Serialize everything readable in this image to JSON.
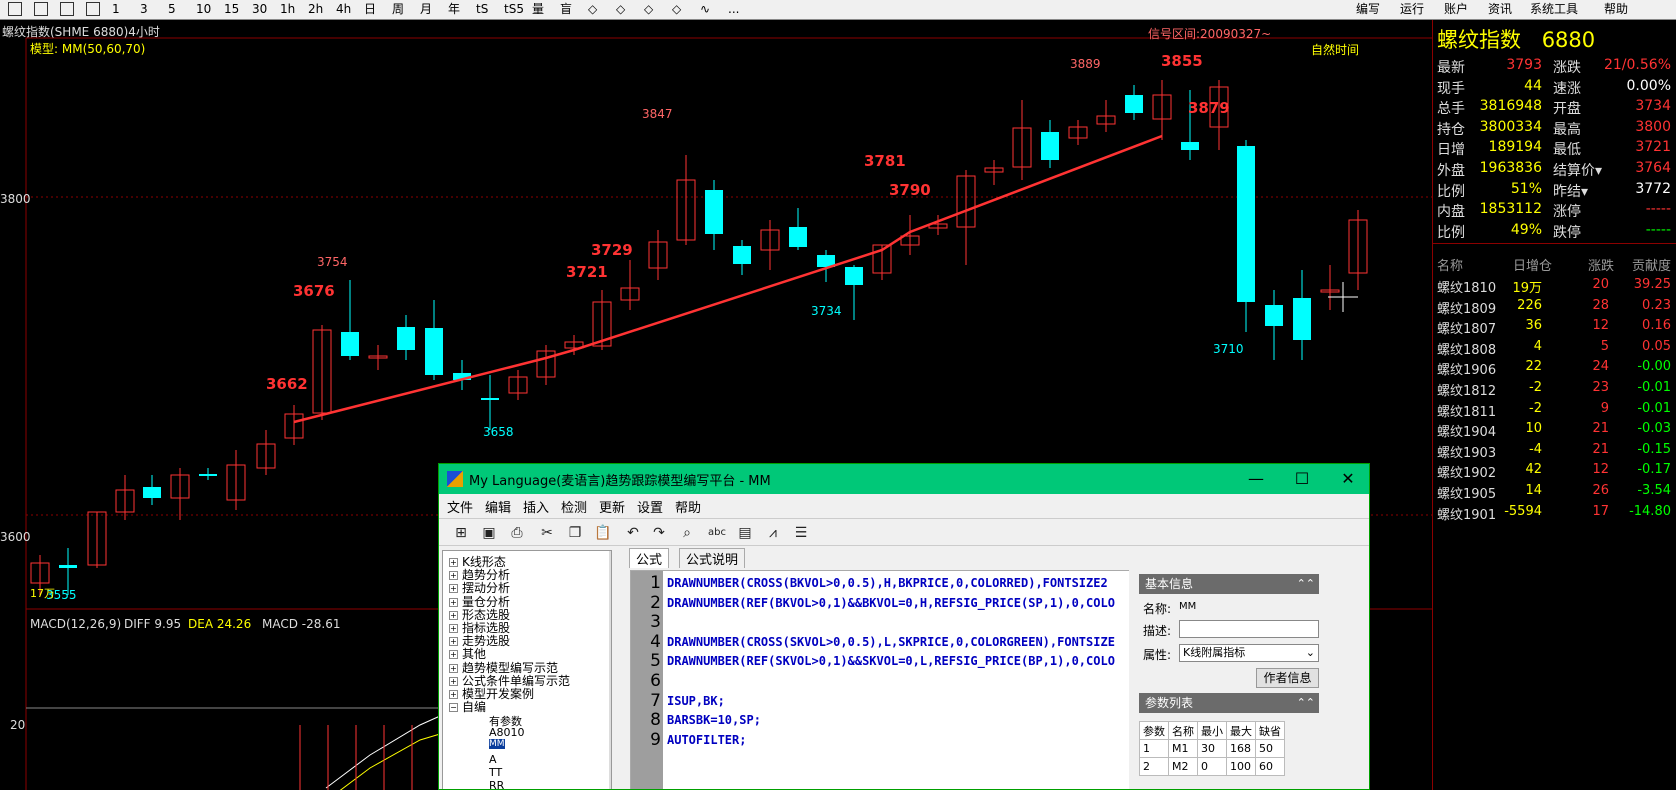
{
  "top_toolbar": {
    "left_items": [
      "1",
      "3",
      "5",
      "10",
      "15",
      "30",
      "1h",
      "2h",
      "4h",
      "日",
      "周",
      "月",
      "年",
      "tS",
      "tS5",
      "量",
      "盲",
      "◇",
      "◇",
      "◇",
      "◇",
      "∿",
      "..."
    ],
    "right_items": [
      "编写",
      "运行",
      "账户",
      "资讯",
      "系统工具",
      "帮助"
    ]
  },
  "chart": {
    "symbol_title": "螺纹指数(SHME 6880)4小时",
    "model_label": "模型: MM(50,60,70)",
    "signal_interval": "信号区间:20090327~",
    "natural_time": "自然时间",
    "y_ticks": [
      "3800",
      "3600",
      "20"
    ],
    "price_labels": {
      "p3889": "3889",
      "p3855": "3855",
      "p3879": "3879",
      "p3847": "3847",
      "p3781": "3781",
      "p3790": "3790",
      "p3754": "3754",
      "p3676": "3676",
      "p3729": "3729",
      "p3721": "3721",
      "p3662": "3662",
      "p3734": "3734",
      "p3710": "3710",
      "p3658": "3658",
      "p3555": "3555",
      "small_17": "17万"
    },
    "macd": {
      "label": "MACD(12,26,9)",
      "diff": "DIFF 9.95",
      "dea": "DEA 24.26",
      "macd": "MACD -28.61"
    },
    "colors": {
      "up": "#ff3333",
      "down": "#00ffff",
      "signal": "#ff3333",
      "grid": "#8b0000"
    }
  },
  "info_panel": {
    "title": "螺纹指数",
    "code": "6880",
    "quotes": [
      {
        "l1": "最新",
        "v1": "3793",
        "c1": "#ff3333",
        "l2": "涨跌",
        "v2": "21/0.56%",
        "c2": "#ff3333"
      },
      {
        "l1": "现手",
        "v1": "44",
        "c1": "#ffff00",
        "l2": "速涨",
        "v2": "0.00%",
        "c2": "#ffffff"
      },
      {
        "l1": "总手",
        "v1": "3816948",
        "c1": "#ffff00",
        "l2": "开盘",
        "v2": "3734",
        "c2": "#ff3333"
      },
      {
        "l1": "持仓",
        "v1": "3800334",
        "c1": "#ffff00",
        "l2": "最高",
        "v2": "3800",
        "c2": "#ff3333"
      },
      {
        "l1": "日增",
        "v1": "189194",
        "c1": "#ffff00",
        "l2": "最低",
        "v2": "3721",
        "c2": "#ff3333"
      },
      {
        "l1": "外盘",
        "v1": "1963836",
        "c1": "#ffff00",
        "l2": "结算价▾",
        "v2": "3764",
        "c2": "#ff3333"
      },
      {
        "l1": "比例",
        "v1": "51%",
        "c1": "#ffff00",
        "l2": "昨结▾",
        "v2": "3772",
        "c2": "#ffffff"
      },
      {
        "l1": "内盘",
        "v1": "1853112",
        "c1": "#ffff00",
        "l2": "涨停",
        "v2": "-----",
        "c2": "#ff3333"
      },
      {
        "l1": "比例",
        "v1": "49%",
        "c1": "#ffff00",
        "l2": "跌停",
        "v2": "-----",
        "c2": "#00ff00"
      }
    ],
    "contracts_header": [
      "名称",
      "日增仓",
      "涨跌",
      "贡献度"
    ],
    "contracts": [
      {
        "name": "螺纹1810",
        "oi": "19万",
        "chg": "20",
        "contrib": "39.25",
        "cc": "#ff3333"
      },
      {
        "name": "螺纹1809",
        "oi": "226",
        "chg": "28",
        "contrib": "0.23",
        "cc": "#ff3333"
      },
      {
        "name": "螺纹1807",
        "oi": "36",
        "chg": "12",
        "contrib": "0.16",
        "cc": "#ff3333"
      },
      {
        "name": "螺纹1808",
        "oi": "4",
        "chg": "5",
        "contrib": "0.05",
        "cc": "#ff3333"
      },
      {
        "name": "螺纹1906",
        "oi": "22",
        "chg": "24",
        "contrib": "-0.00",
        "cc": "#00ff00"
      },
      {
        "name": "螺纹1812",
        "oi": "-2",
        "chg": "23",
        "contrib": "-0.01",
        "cc": "#00ff00"
      },
      {
        "name": "螺纹1811",
        "oi": "-2",
        "chg": "9",
        "contrib": "-0.01",
        "cc": "#00ff00"
      },
      {
        "name": "螺纹1904",
        "oi": "10",
        "chg": "21",
        "contrib": "-0.03",
        "cc": "#00ff00"
      },
      {
        "name": "螺纹1903",
        "oi": "-4",
        "chg": "21",
        "contrib": "-0.15",
        "cc": "#00ff00"
      },
      {
        "name": "螺纹1902",
        "oi": "42",
        "chg": "12",
        "contrib": "-0.17",
        "cc": "#00ff00"
      },
      {
        "name": "螺纹1905",
        "oi": "14",
        "chg": "26",
        "contrib": "-3.54",
        "cc": "#00ff00"
      },
      {
        "name": "螺纹1901",
        "oi": "-5594",
        "chg": "17",
        "contrib": "-14.80",
        "cc": "#00ff00"
      }
    ]
  },
  "editor": {
    "title": "My Language(麦语言)趋势跟踪模型编写平台 - MM",
    "menu": [
      "文件",
      "编辑",
      "插入",
      "检测",
      "更新",
      "设置",
      "帮助"
    ],
    "tabs": [
      "公式",
      "公式说明"
    ],
    "tree": [
      "K线形态",
      "趋势分析",
      "摆动分析",
      "量仓分析",
      "形态选股",
      "指标选股",
      "走势选股",
      "其他",
      "趋势模型编写示范",
      "公式条件单编写示范",
      "模型开发案例",
      "自编"
    ],
    "tree_sub": [
      "有参数",
      "A8010",
      "MM",
      "A",
      "TT",
      "RR"
    ],
    "code_lines": [
      "DRAWNUMBER(CROSS(BKVOL>0,0.5),H,BKPRICE,0,COLORRED),FONTSIZE2",
      "DRAWNUMBER(REF(BKVOL>0,1)&&BKVOL=0,H,REFSIG_PRICE(SP,1),0,COLO",
      "",
      "DRAWNUMBER(CROSS(SKVOL>0,0.5),L,SKPRICE,0,COLORGREEN),FONTSIZE",
      "DRAWNUMBER(REF(SKVOL>0,1)&&SKVOL=0,L,REFSIG_PRICE(BP,1),0,COLO",
      "",
      "ISUP,BK;",
      "BARSBK=10,SP;",
      "AUTOFILTER;"
    ],
    "props": {
      "basic_info": "基本信息",
      "name_label": "名称:",
      "name_value": "MM",
      "desc_label": "描述:",
      "attr_label": "属性:",
      "attr_value": "K线附属指标",
      "author_btn": "作者信息",
      "param_list": "参数列表",
      "param_headers": [
        "参数",
        "名称",
        "最小",
        "最大",
        "缺省"
      ],
      "params": [
        [
          "1",
          "M1",
          "30",
          "168",
          "50"
        ],
        [
          "2",
          "M2",
          "0",
          "100",
          "60"
        ]
      ]
    }
  }
}
